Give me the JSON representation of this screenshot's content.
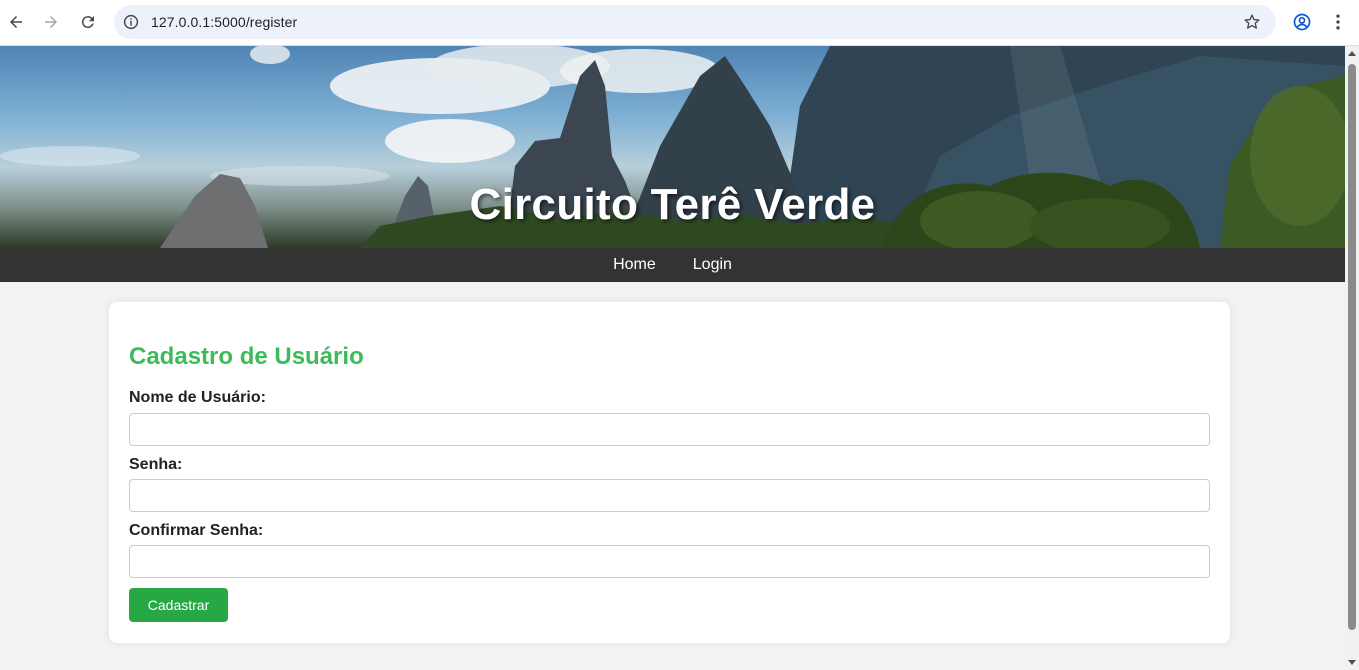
{
  "browser": {
    "url": "127.0.0.1:5000/register",
    "icons": [
      "back-arrow-icon",
      "forward-arrow-icon",
      "reload-icon",
      "site-info-icon",
      "bookmark-star-icon",
      "profile-icon",
      "more-menu-icon"
    ]
  },
  "header": {
    "title": "Circuito Terê Verde"
  },
  "nav": {
    "items": [
      {
        "label": "Home"
      },
      {
        "label": "Login"
      }
    ]
  },
  "form": {
    "title": "Cadastro de Usuário",
    "username_label": "Nome de Usuário:",
    "username_value": "",
    "password_label": "Senha:",
    "password_value": "",
    "confirm_label": "Confirmar Senha:",
    "confirm_value": "",
    "submit_label": "Cadastrar"
  },
  "colors": {
    "heading": "#3dbb5b",
    "button": "#28a745",
    "navbar": "#333333",
    "page_bg": "#f2f2f2"
  }
}
